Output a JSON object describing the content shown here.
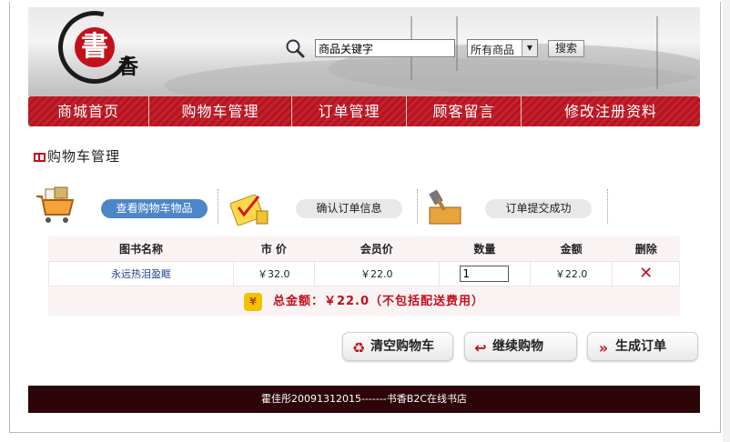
{
  "header": {
    "logo_char": "書",
    "logo_sub": "香",
    "search": {
      "placeholder": "商品关键字",
      "value": "商品关键字"
    },
    "category_select": {
      "selected": "所有商品"
    },
    "search_button": "搜索"
  },
  "nav": {
    "items": [
      {
        "label": "商城首页"
      },
      {
        "label": "购物车管理"
      },
      {
        "label": "订单管理"
      },
      {
        "label": "顾客留言"
      },
      {
        "label": "修改注册资料"
      }
    ]
  },
  "section": {
    "title": "购物车管理"
  },
  "steps": [
    {
      "label": "查看购物车物品",
      "active": true
    },
    {
      "label": "确认订单信息",
      "active": false
    },
    {
      "label": "订单提交成功",
      "active": false
    }
  ],
  "cart": {
    "headers": [
      "图书名称",
      "市 价",
      "会员价",
      "数量",
      "金额",
      "删除"
    ],
    "rows": [
      {
        "title": "永远热泪盈眶",
        "market_price": "￥32.0",
        "member_price": "￥22.0",
        "quantity": "1",
        "amount": "￥22.0"
      }
    ],
    "total_text": "总金额：￥22.0（不包括配送费用）"
  },
  "actions": {
    "clear": "清空购物车",
    "continue": "继续购物",
    "checkout": "生成订单"
  },
  "footer": {
    "text": "霍佳彤20091312015-------书香B2C在线书店"
  },
  "colors": {
    "brand_red": "#c3101b",
    "nav_red": "#b01622",
    "step_active": "#4d86c8",
    "footer_bg": "#2d0509"
  }
}
